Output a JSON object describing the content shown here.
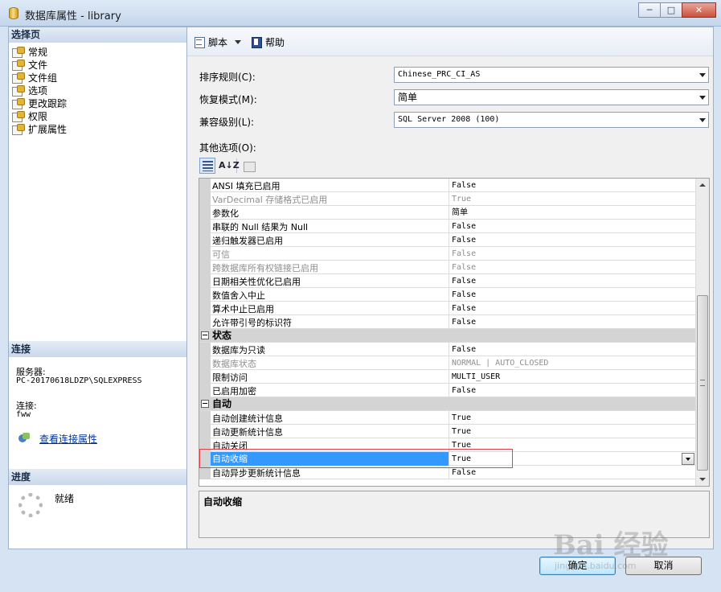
{
  "window": {
    "title": "数据库属性 - library",
    "min": "─",
    "max": "□",
    "close": "✕"
  },
  "sidebar": {
    "header": "选择页",
    "items": [
      "常规",
      "文件",
      "文件组",
      "选项",
      "更改跟踪",
      "权限",
      "扩展属性"
    ],
    "connection": {
      "header": "连接",
      "server_label": "服务器:",
      "server_value": "PC-20170618LDZP\\SQLEXPRESS",
      "conn_label": "连接:",
      "conn_value": "fww",
      "link": "查看连接属性"
    },
    "progress": {
      "header": "进度",
      "status": "就绪"
    }
  },
  "toolbar": {
    "script": "脚本",
    "help": "帮助"
  },
  "form": {
    "collation": {
      "label": "排序规则(C):",
      "value": "Chinese_PRC_CI_AS"
    },
    "recovery": {
      "label": "恢复模式(M):",
      "value": "简单"
    },
    "compat": {
      "label": "兼容级别(L):",
      "value": "SQL Server 2008 (100)"
    },
    "other": {
      "label": "其他选项(O):"
    }
  },
  "grid": {
    "alpha_icon": "A↓Z",
    "rows": [
      {
        "name": "ANSI 填充已启用",
        "value": "False"
      },
      {
        "name": "VarDecimal 存储格式已启用",
        "value": "True",
        "disabled": true
      },
      {
        "name": "参数化",
        "value": "简单"
      },
      {
        "name": "串联的 Null 结果为 Null",
        "value": "False"
      },
      {
        "name": "递归触发器已启用",
        "value": "False"
      },
      {
        "name": "可信",
        "value": "False",
        "disabled": true
      },
      {
        "name": "跨数据库所有权链接已启用",
        "value": "False",
        "disabled": true
      },
      {
        "name": "日期相关性优化已启用",
        "value": "False"
      },
      {
        "name": "数值舍入中止",
        "value": "False"
      },
      {
        "name": "算术中止已启用",
        "value": "False"
      },
      {
        "name": "允许带引号的标识符",
        "value": "False"
      },
      {
        "category": "状态"
      },
      {
        "name": "数据库为只读",
        "value": "False"
      },
      {
        "name": "数据库状态",
        "value": "NORMAL | AUTO_CLOSED",
        "disabled": true
      },
      {
        "name": "限制访问",
        "value": "MULTI_USER"
      },
      {
        "name": "已启用加密",
        "value": "False"
      },
      {
        "category": "自动"
      },
      {
        "name": "自动创建统计信息",
        "value": "True"
      },
      {
        "name": "自动更新统计信息",
        "value": "True"
      },
      {
        "name": "自动关闭",
        "value": "True"
      },
      {
        "name": "自动收缩",
        "value": "True",
        "selected": true
      },
      {
        "name": "自动异步更新统计信息",
        "value": "False"
      }
    ]
  },
  "description": {
    "title": "自动收缩"
  },
  "buttons": {
    "ok": "确定",
    "cancel": "取消"
  },
  "watermark": {
    "text": "Bai 经验",
    "url": "jingyan.baidu.com"
  }
}
